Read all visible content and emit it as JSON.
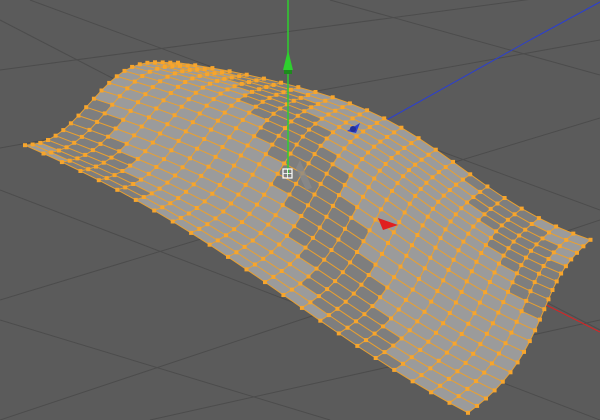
{
  "viewport": {
    "projection": "perspective",
    "background_color": "#5b5b5b",
    "grid_color": "#4c4c4c",
    "selection": {
      "mode": "points",
      "point_color": "#f7a52c",
      "edge_color": "#e9a030",
      "face_color": "#9b9b9b",
      "face_shade_color": "#7e7e7e"
    },
    "mesh": {
      "type": "wavy-plane",
      "segments_u": 24,
      "segments_v": 20
    },
    "axes": {
      "x_color": "#e02020",
      "y_color": "#2ecf2e",
      "z_color": "#2b3fd0"
    },
    "icons": [
      "move-gizmo",
      "axis-x-handle-icon",
      "axis-y-handle-icon",
      "axis-z-handle-icon",
      "pivot-icon"
    ]
  }
}
